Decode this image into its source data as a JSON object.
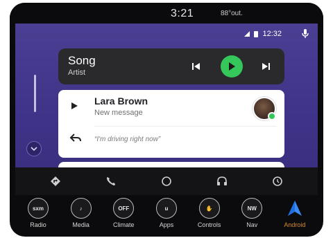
{
  "head_unit": {
    "clock": "3:21",
    "outside_temp": "88°out."
  },
  "status_bar": {
    "time": "12:32",
    "icons": [
      "signal-icon",
      "battery-icon",
      "microphone-icon"
    ]
  },
  "media_card": {
    "title": "Song",
    "subtitle": "Artist",
    "controls": [
      "previous-track-icon",
      "play-icon",
      "next-track-icon"
    ],
    "accent": "#35c759"
  },
  "message_card": {
    "sender": "Lara Brown",
    "preview": "New message",
    "reply_suggestion": "“I'm driving right now”"
  },
  "android_auto_nav": {
    "icons": [
      "navigation-icon",
      "phone-icon",
      "home-icon",
      "headphones-icon",
      "notifications-icon"
    ]
  },
  "dock": {
    "items": [
      {
        "label": "Radio",
        "badge": "sxm"
      },
      {
        "label": "Media",
        "badge": "♪"
      },
      {
        "label": "Climate",
        "badge": "OFF"
      },
      {
        "label": "Apps",
        "badge": "u"
      },
      {
        "label": "Controls",
        "badge": "✋"
      },
      {
        "label": "Nav",
        "badge": "NW"
      },
      {
        "label": "Android",
        "badge": ""
      }
    ],
    "active_color": "#d98a2a"
  },
  "theme": {
    "screen_bg": "#433889",
    "card_bg": "#2a2a2d",
    "navbar_bg": "#141417"
  }
}
